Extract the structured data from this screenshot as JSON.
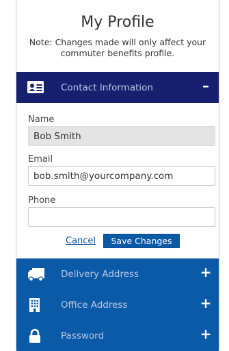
{
  "page": {
    "title": "My Profile",
    "note": "Note: Changes made will only affect your commuter benefits profile."
  },
  "sections": {
    "contact": {
      "label": "Contact Information",
      "toggle": "–",
      "icon": "contact-card-icon",
      "expanded": true
    },
    "delivery": {
      "label": "Delivery Address",
      "toggle": "+",
      "icon": "truck-icon"
    },
    "office": {
      "label": "Office Address",
      "toggle": "+",
      "icon": "office-building-icon"
    },
    "password": {
      "label": "Password",
      "toggle": "+",
      "icon": "lock-icon"
    }
  },
  "form": {
    "name": {
      "label": "Name",
      "value": "Bob Smith"
    },
    "email": {
      "label": "Email",
      "value": "bob.smith@yourcompany.com"
    },
    "phone": {
      "label": "Phone",
      "value": ""
    }
  },
  "actions": {
    "cancel_label": "Cancel",
    "save_label": "Save Changes"
  },
  "colors": {
    "active_header": "#17206e",
    "collapsed_header": "#0b5aa8",
    "header_label": "#b7c7e6",
    "link": "#0b4fa0"
  }
}
